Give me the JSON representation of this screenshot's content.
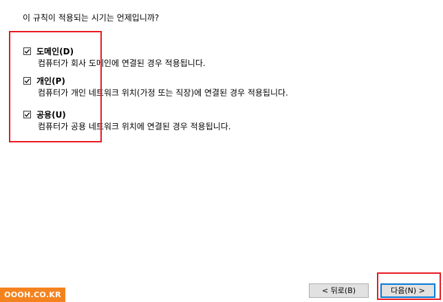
{
  "question": "이 규칙이 적용되는 시기는 언제입니까?",
  "options": [
    {
      "label": "도메인(D)",
      "checked": true,
      "description": "컴퓨터가 회사 도메인에 연결된 경우 적용됩니다."
    },
    {
      "label": "개인(P)",
      "checked": true,
      "description": "컴퓨터가 개인 네트워크 위치(가정 또는 직장)에 연결된 경우 적용됩니다."
    },
    {
      "label": "공용(U)",
      "checked": true,
      "description": "컴퓨터가 공용 네트워크 위치에 연결된 경우 적용됩니다."
    }
  ],
  "buttons": {
    "back": "< 뒤로(B)",
    "next": "다음(N) >"
  },
  "watermark": "OOOH.CO.KR",
  "colors": {
    "highlight": "#e8171f",
    "watermark_bg": "#f4831f",
    "focus_border": "#0078d7"
  },
  "icons": {
    "check": "checkmark-icon"
  }
}
